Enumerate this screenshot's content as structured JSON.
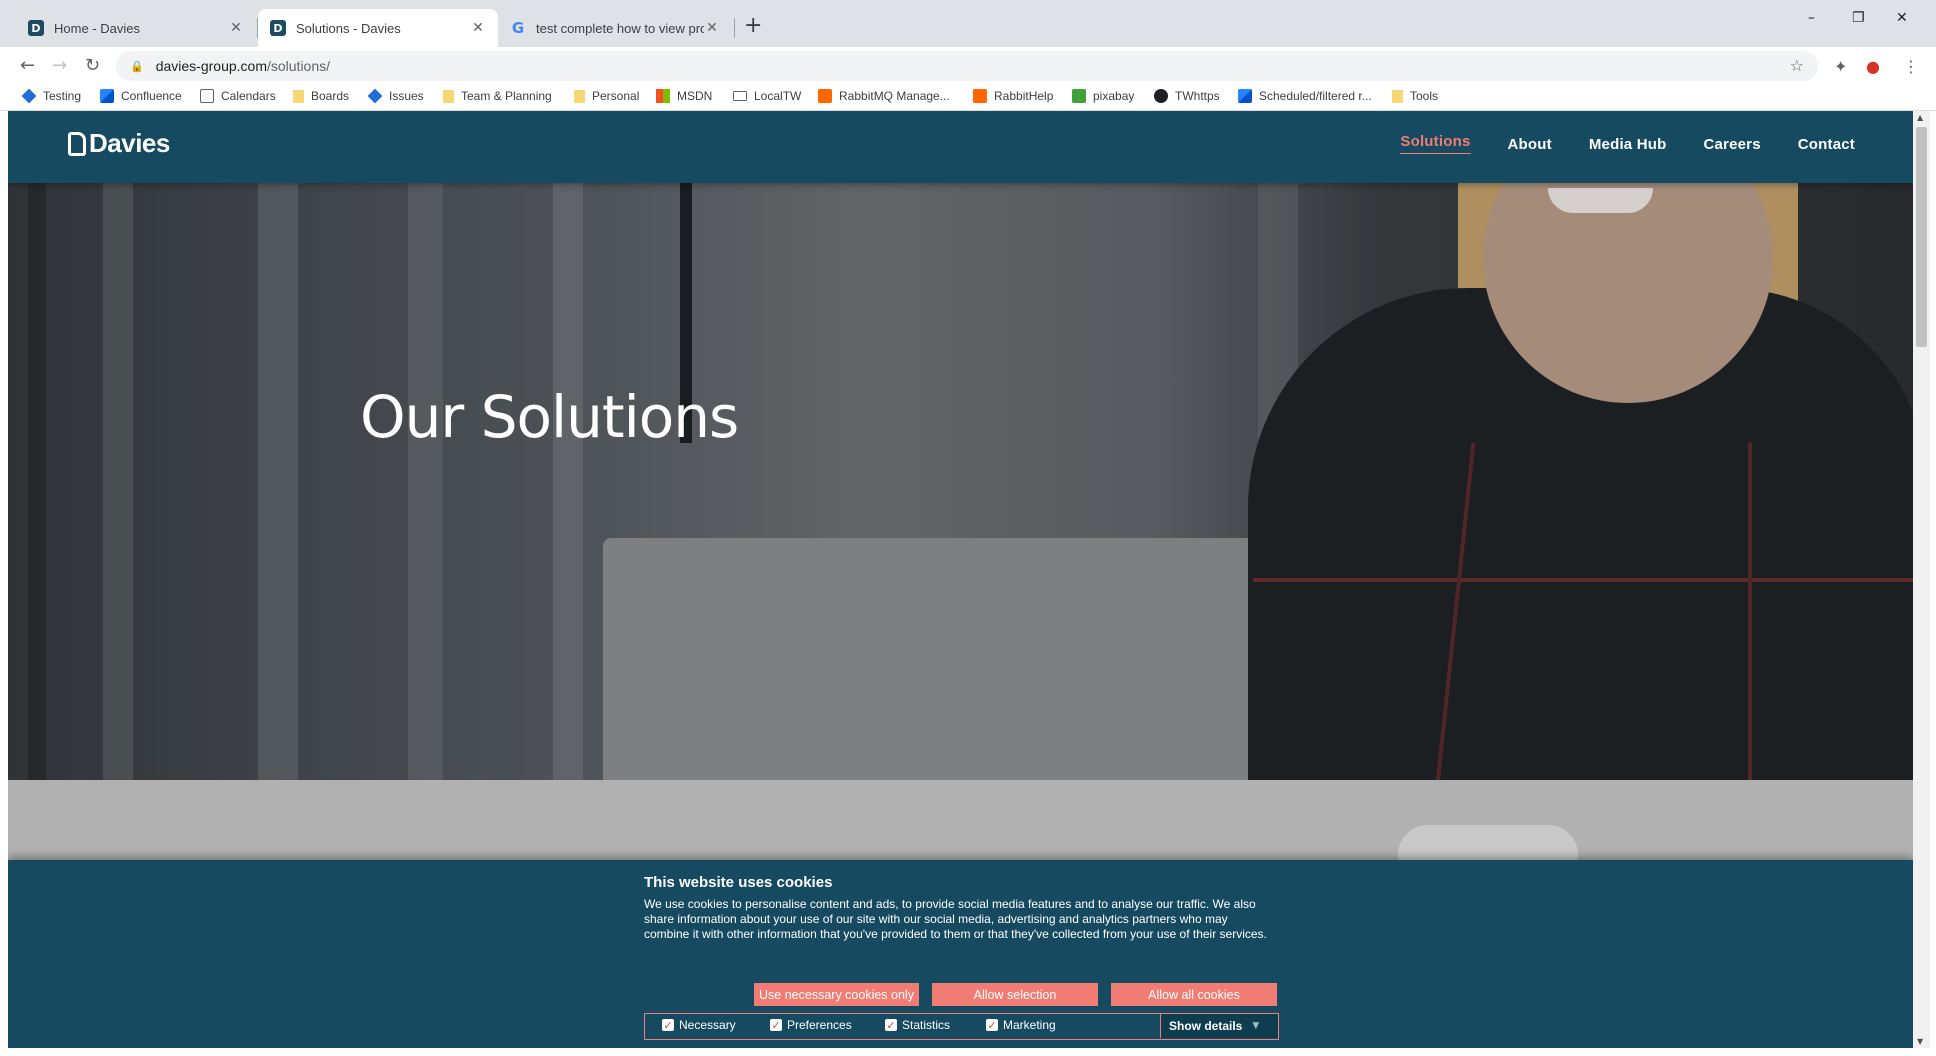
{
  "browser": {
    "tabs": [
      {
        "title": "Home - Davies",
        "favicon": "davies-icon"
      },
      {
        "title": "Solutions - Davies",
        "favicon": "davies-icon"
      },
      {
        "title": "test complete how to view proje",
        "favicon": "google-icon"
      }
    ],
    "new_tab": "+",
    "window_controls": {
      "minimize": "–",
      "restore": "❐",
      "close": "✕"
    },
    "address": {
      "host": "davies-group.com",
      "path": "/solutions/"
    },
    "bookmarks": [
      {
        "label": "Testing",
        "icon": "jira-diamond-icon"
      },
      {
        "label": "Confluence",
        "icon": "confluence-icon"
      },
      {
        "label": "Calendars",
        "icon": "calendar-icon"
      },
      {
        "label": "Boards",
        "icon": "folder-icon"
      },
      {
        "label": "Issues",
        "icon": "jira-diamond-icon"
      },
      {
        "label": "Team & Planning",
        "icon": "folder-icon"
      },
      {
        "label": "Personal",
        "icon": "folder-icon"
      },
      {
        "label": "MSDN",
        "icon": "microsoft-icon"
      },
      {
        "label": "LocalTW",
        "icon": "laptop-icon"
      },
      {
        "label": "RabbitMQ Manage...",
        "icon": "rabbitmq-icon"
      },
      {
        "label": "RabbitHelp",
        "icon": "rabbitmq-icon"
      },
      {
        "label": "pixabay",
        "icon": "pixabay-icon"
      },
      {
        "label": "TWhttps",
        "icon": "tw-icon"
      },
      {
        "label": "Scheduled/filtered r...",
        "icon": "confluence-icon"
      },
      {
        "label": "Tools",
        "icon": "folder-icon"
      }
    ]
  },
  "site": {
    "logo": "Davies",
    "nav": [
      "Solutions",
      "About",
      "Media Hub",
      "Careers",
      "Contact"
    ],
    "active_nav": "Solutions",
    "hero_title": "Our Solutions",
    "accent_color": "#f07c74",
    "header_color": "#154a60"
  },
  "cookie": {
    "title": "This website uses cookies",
    "body": "We use cookies to personalise content and ads, to provide social media features and to analyse our traffic. We also share information about your use of our site with our social media, advertising and analytics partners who may combine it with other information that you've provided to them or that they've collected from your use of their services.",
    "buttons": [
      "Use necessary cookies only",
      "Allow selection",
      "Allow all cookies"
    ],
    "options": [
      {
        "label": "Necessary",
        "checked": true
      },
      {
        "label": "Preferences",
        "checked": true
      },
      {
        "label": "Statistics",
        "checked": true
      },
      {
        "label": "Marketing",
        "checked": true
      }
    ],
    "show_details": "Show details"
  }
}
